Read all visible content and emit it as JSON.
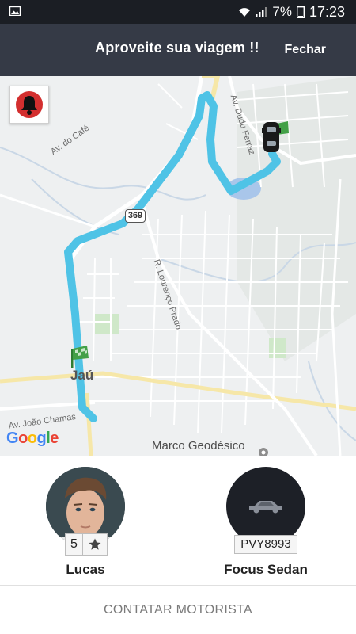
{
  "status_bar": {
    "battery_text": "7%",
    "time": "17:23"
  },
  "header": {
    "title": "Aproveite sua viagem !!",
    "close_label": "Fechar"
  },
  "map": {
    "labels": {
      "av_dudu": "Av. Dudu Ferraz",
      "av_cafe": "Av. do Café",
      "r_lourenco": "R. Lourenço Prado",
      "av_joao": "Av. João Chamas",
      "route_shield": "369",
      "city": "Jaú",
      "landmark": "Marco Geodésico"
    },
    "google_logo": [
      "G",
      "o",
      "o",
      "g",
      "l",
      "e"
    ],
    "colors": {
      "route": "#4fc3e6",
      "alarm": "#d32f2f"
    }
  },
  "driver": {
    "name": "Lucas",
    "rating": "5"
  },
  "vehicle": {
    "plate": "PVY8993",
    "model": "Focus Sedan"
  },
  "actions": {
    "contact_label": "CONTATAR MOTORISTA"
  }
}
